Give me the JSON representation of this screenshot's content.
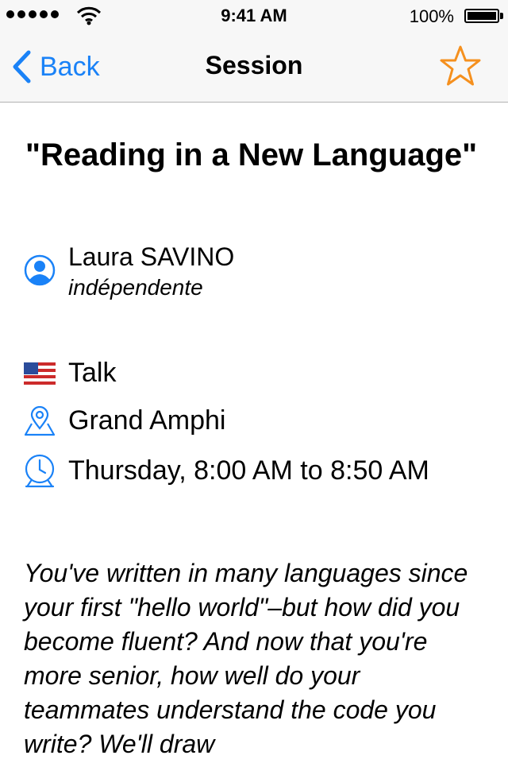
{
  "status_bar": {
    "time": "9:41 AM",
    "battery_percent": "100%"
  },
  "nav": {
    "back_label": "Back",
    "title": "Session"
  },
  "session": {
    "title": "\"Reading in a New Language\"",
    "speaker_name": "Laura SAVINO",
    "speaker_company": "indépendente",
    "type": "Talk",
    "room": "Grand Amphi",
    "time": "Thursday, 8:00 AM to 8:50 AM",
    "description": "You've written in many languages since your first \"hello world\"–but how did you become fluent? And now that you're more senior, how well do your teammates understand the code you write? We'll draw"
  },
  "colors": {
    "accent_blue": "#1a82f7",
    "star_orange": "#f5901e"
  },
  "icons": {
    "back": "chevron-left-icon",
    "favorite": "star-outline-icon",
    "speaker": "person-circle-icon",
    "language": "us-flag-icon",
    "room": "map-pin-icon",
    "time": "clock-icon"
  }
}
